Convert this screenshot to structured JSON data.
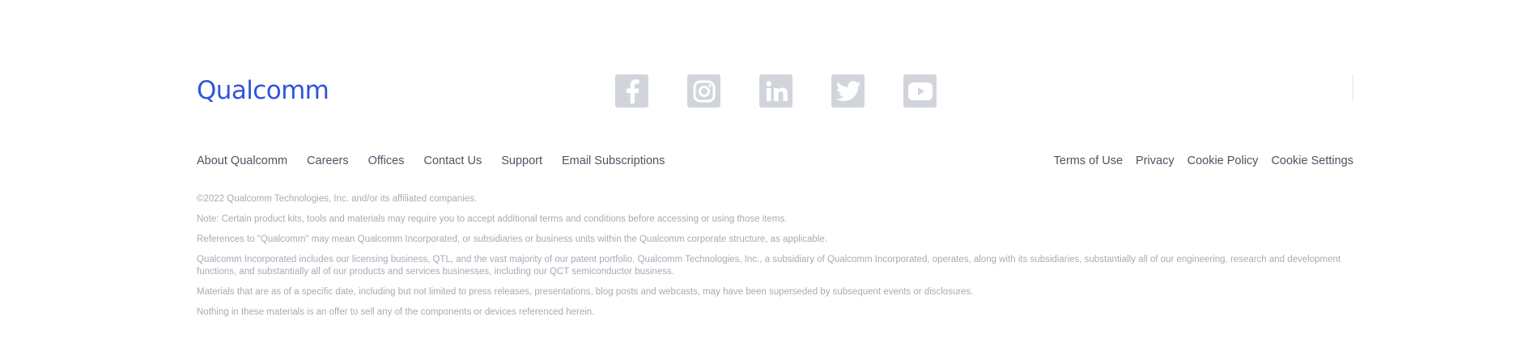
{
  "logo": {
    "text": "Qualcomm",
    "color": "#3253DC"
  },
  "social": [
    {
      "name": "facebook-icon",
      "label": "Facebook"
    },
    {
      "name": "instagram-icon",
      "label": "Instagram"
    },
    {
      "name": "linkedin-icon",
      "label": "LinkedIn"
    },
    {
      "name": "twitter-icon",
      "label": "Twitter"
    },
    {
      "name": "youtube-icon",
      "label": "YouTube"
    }
  ],
  "nav_left": {
    "about": "About Qualcomm",
    "careers": "Careers",
    "offices": "Offices",
    "contact": "Contact Us",
    "support": "Support",
    "email": "Email Subscriptions"
  },
  "nav_right": {
    "terms": "Terms of Use",
    "privacy": "Privacy",
    "cookie_policy": "Cookie Policy",
    "cookie_settings": "Cookie Settings"
  },
  "legal": {
    "copyright": "©2022 Qualcomm Technologies, Inc. and/or its affiliated companies.",
    "note": "Note: Certain product kits, tools and materials may require you to accept additional terms and conditions before accessing or using those items.",
    "references": "References to \"Qualcomm\" may mean Qualcomm Incorporated, or subsidiaries or business units within the Qualcomm corporate structure, as applicable.",
    "qct": "Qualcomm Incorporated includes our licensing business, QTL, and the vast majority of our patent portfolio. Qualcomm Technologies, Inc., a subsidiary of Qualcomm Incorporated, operates, along with its subsidiaries, substantially all of our engineering, research and development functions, and substantially all of our products and services businesses, including our QCT semiconductor business.",
    "materials": "Materials that are as of a specific date, including but not limited to press releases, presentations, blog posts and webcasts, may have been superseded by subsequent events or disclosures.",
    "offer": "Nothing in these materials is an offer to sell any of the components or devices referenced herein."
  }
}
